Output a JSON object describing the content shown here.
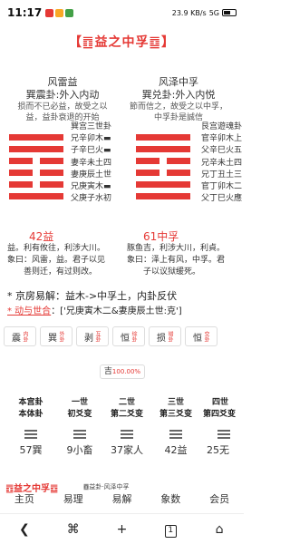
{
  "status": {
    "time": "11:17",
    "net": "23.9 KB/s",
    "signal": "5G",
    "battery": "50"
  },
  "title": "【䷩益之中孚䷼】",
  "left_gua": {
    "name": "风雷益",
    "sub": "巽震卦:外入内动",
    "desc1": "损而不已必益，故受之以",
    "desc2": "益，益卦衰退的开始"
  },
  "right_gua": {
    "name": "风泽中孚",
    "sub": "巽兑卦:外入内悦",
    "desc1": "節而信之，故受之以中孚，",
    "desc2": "中孚卦是誠信"
  },
  "left_yao": [
    "巽宫三世卦",
    "兄辛卯木▬",
    "子辛巳火▬",
    "妻辛未土四",
    "妻庚辰土世",
    "兄庚寅木▬",
    "父庚子水初"
  ],
  "right_yao": [
    "艮宫遊魂卦",
    "官辛卯木上",
    "父辛巳火五",
    "兄辛未土四",
    "兄丁丑土三",
    "官丁卯木二",
    "父丁巳火應"
  ],
  "left_num": "42益",
  "right_num": "61中孚",
  "left_tuan": [
    "益。利有攸往，利涉大川。",
    "象曰：风雷，益。君子以见",
    "善则迁，有过则改。"
  ],
  "right_tuan": [
    "豚鱼吉，利涉大川，利貞。",
    "象曰：泽上有风，中孚。君",
    "子以议狱缓死。"
  ],
  "jingfang": "* 京房易解：益木->中孚土，内卦反伏",
  "dong_label": "* 动与世合",
  "dong_value": "：['兄庚寅木二&妻庚辰土世:克']",
  "bagua": [
    {
      "label": "震",
      "tag": "内卦"
    },
    {
      "label": "巽",
      "tag": "外卦"
    },
    {
      "label": "剥",
      "tag": "互卦"
    },
    {
      "label": "恒",
      "tag": "综卦"
    },
    {
      "label": "损",
      "tag": "错卦"
    },
    {
      "label": "恒",
      "tag": "交卦"
    }
  ],
  "ji": {
    "label": "吉",
    "pct": "100.00%"
  },
  "bianhua": [
    {
      "top": "本宫卦",
      "sub": "本体卦",
      "gua": "57巽"
    },
    {
      "top": "一世",
      "sub": "初爻变",
      "gua": "9小畜"
    },
    {
      "top": "二世",
      "sub": "第二爻变",
      "gua": "37家人"
    },
    {
      "top": "三世",
      "sub": "第三爻变",
      "gua": "42益"
    },
    {
      "top": "四世",
      "sub": "第四爻变",
      "gua": "25无"
    }
  ],
  "bottom_strip": {
    "left": "䷩益之中孚䷼",
    "mid": "䷩益卦·风泽中孚"
  },
  "nav": [
    "主页",
    "易理",
    "易解",
    "象数",
    "会员"
  ]
}
